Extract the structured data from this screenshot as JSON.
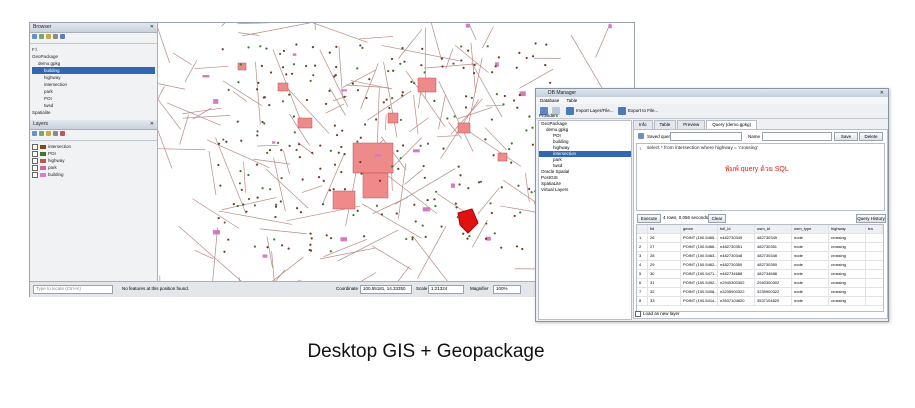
{
  "qgis": {
    "browser_title": "Browser",
    "browser_items": [
      "F:\\",
      "GeoPackage",
      "demo.gpkg",
      "building",
      "highway",
      "intersection",
      "park",
      "POI",
      "twsd",
      "Spatialite"
    ],
    "layers_title": "Layers",
    "layers": [
      {
        "name": "intersection",
        "color": "#8b4513"
      },
      {
        "name": "POI",
        "color": "#3a7a2e"
      },
      {
        "name": "highway",
        "color": "#b55b4d"
      },
      {
        "name": "park",
        "color": "#c86b9c"
      },
      {
        "name": "building",
        "color": "#e07acb"
      }
    ],
    "status": {
      "locate_placeholder": "Type to locate (Ctrl+K)",
      "message": "No features at this position found.",
      "coordinate_label": "Coordinate",
      "coordinate_value": "100.55181, 14.33350",
      "scale_label": "Scale",
      "scale_value": "1:21324",
      "magnifier_label": "Magnifier",
      "magnifier_value": "100%"
    }
  },
  "dbmanager": {
    "title": "DB Manager",
    "menu": [
      "Database",
      "Table"
    ],
    "toolbar": [
      "Import Layer/File...",
      "Export to File..."
    ],
    "providers_label": "Providers",
    "tree": [
      "GeoPackage",
      "demo.gpkg",
      "POI",
      "building",
      "highway",
      "intersection",
      "park",
      "twsd",
      "Oracle Spatial",
      "PostGIS",
      "SpatiaLite",
      "Virtual Layers"
    ],
    "tabs": [
      "Info",
      "Table",
      "Preview",
      "Query (demo.gpkg)"
    ],
    "saved_query_label": "Saved query",
    "name_label": "Name",
    "save_label": "Save",
    "delete_label": "Delete",
    "sql": "select * from intersection where highway = 'crossing'",
    "annotation": "พิมพ์ query ด้วย SQL",
    "execute_label": "Execute",
    "exec_info": "4 rows, 0.056 seconds",
    "clear_label": "Clear",
    "history_label": "Query History",
    "columns": [
      "fid",
      "geom",
      "full_id",
      "osm_id",
      "osm_type",
      "highway",
      "tra"
    ],
    "rows": [
      {
        "n": "1",
        "fid": "26",
        "geom": "POINT (100.5465...)",
        "full_id": "n482730349",
        "osm_id": "482730349",
        "osm_type": "node",
        "highway": "crossing"
      },
      {
        "n": "2",
        "fid": "27",
        "geom": "POINT (100.5466...)",
        "full_id": "n482730351",
        "osm_id": "482730351",
        "osm_type": "node",
        "highway": "crossing"
      },
      {
        "n": "3",
        "fid": "28",
        "geom": "POINT (100.5463...)",
        "full_id": "n482730348",
        "osm_id": "482730348",
        "osm_type": "node",
        "highway": "crossing"
      },
      {
        "n": "4",
        "fid": "29",
        "geom": "POINT (100.5462...)",
        "full_id": "n482730350",
        "osm_id": "482730350",
        "osm_type": "node",
        "highway": "crossing"
      },
      {
        "n": "5",
        "fid": "30",
        "geom": "POINT (100.5471...)",
        "full_id": "n482734688",
        "osm_id": "482734688",
        "osm_type": "node",
        "highway": "crossing"
      },
      {
        "n": "6",
        "fid": "31",
        "geom": "POINT (100.5492...)",
        "full_id": "n2940300302",
        "osm_id": "2940300302",
        "osm_type": "node",
        "highway": "crossing"
      },
      {
        "n": "7",
        "fid": "32",
        "geom": "POINT (100.5408...)",
        "full_id": "n3235900322",
        "osm_id": "3235900322",
        "osm_type": "node",
        "highway": "crossing"
      },
      {
        "n": "8",
        "fid": "33",
        "geom": "POINT (100.5414...)",
        "full_id": "n3537104820",
        "osm_id": "3537104820",
        "osm_type": "node",
        "highway": "crossing"
      }
    ],
    "load_as_layer_label": "Load as new layer"
  },
  "caption": "Desktop GIS + Geopackage"
}
